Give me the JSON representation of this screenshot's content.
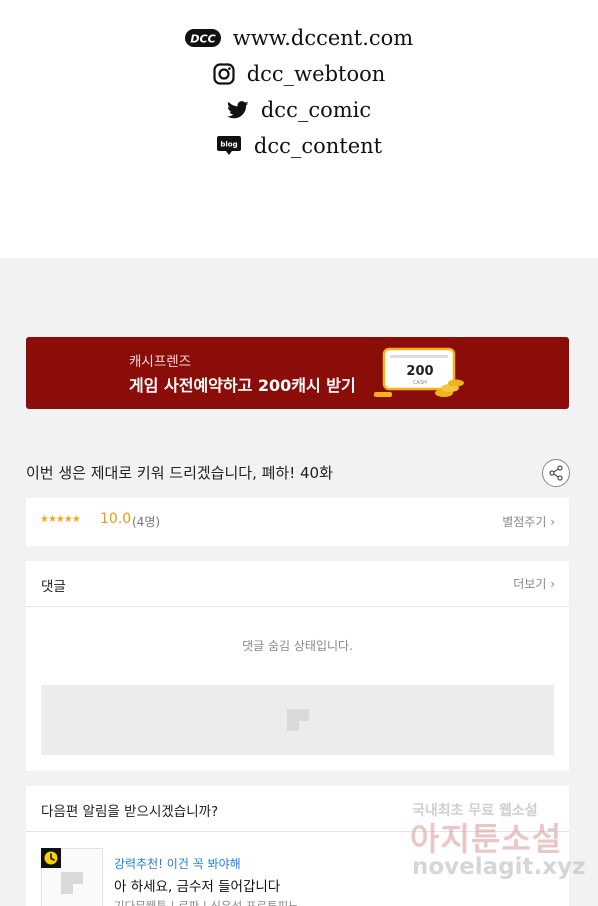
{
  "social": {
    "website": "www.dccent.com",
    "instagram": "dcc_webtoon",
    "twitter": "dcc_comic",
    "blog": "dcc_content",
    "blog_badge": "blog",
    "logo_text": "DCC"
  },
  "banner": {
    "subtitle": "캐시프렌즈",
    "headline": "게임 사전예약하고 200캐시 받기",
    "ticket_amount": "200",
    "ticket_unit": "CASH"
  },
  "episode": {
    "title": "이번 생은 제대로 키워 드리겠습니다, 폐하! 40화"
  },
  "rating": {
    "stars": "★★★★★",
    "score": "10.0",
    "count": "(4명)",
    "rate_link": "별점주기 ›"
  },
  "comments": {
    "title": "댓글",
    "more": "더보기 ›",
    "hidden_message": "댓글 숨김 상태입니다."
  },
  "alert": {
    "question": "다음편 알림을 받으시겠습니까?",
    "rec_label": "강력추천! 이건 꼭 봐야해",
    "rec_title": "아 하세요, 금수저 들어갑니다",
    "rec_meta": "기다무웹툰 | 로판 | 신유성,포르투피노"
  },
  "watermark": {
    "line1": "국내최초 무료 웹소설",
    "line2": "아지툰소설",
    "line3": "novelagit.xyz"
  },
  "colors": {
    "banner_bg": "#8b0d0a",
    "star": "#f5a623",
    "score": "#e89a0d",
    "rec_label": "#1e7fe0",
    "page_bg": "#f2f2f2"
  }
}
